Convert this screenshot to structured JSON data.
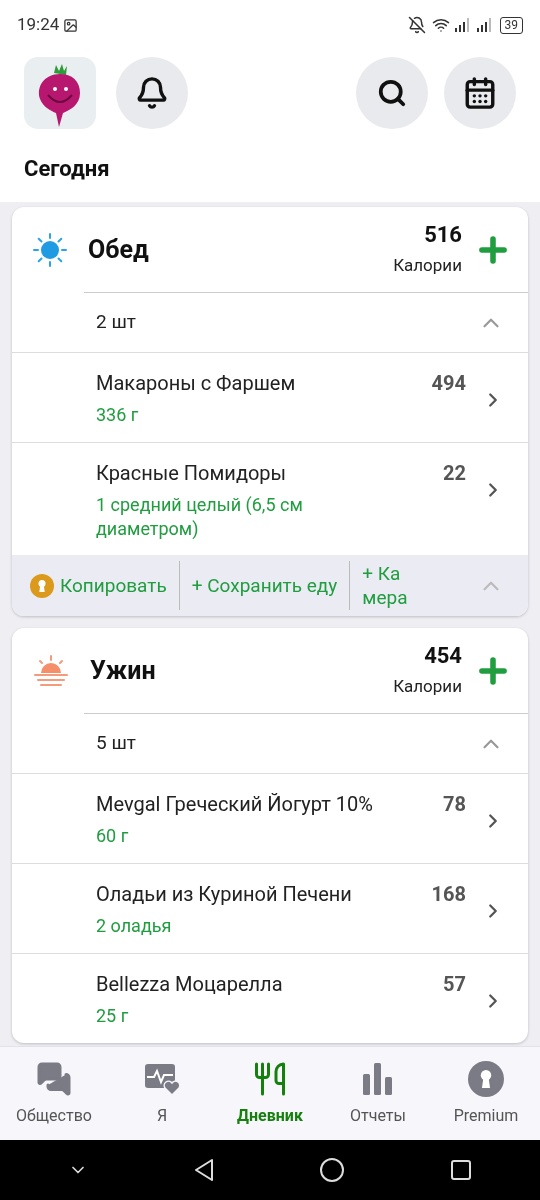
{
  "status_bar": {
    "time": "19:24",
    "battery": "39"
  },
  "title": "Сегодня",
  "meals": [
    {
      "kind": "lunch",
      "name": "Обед",
      "calories": "516",
      "calories_label": "Калории",
      "count": "2 шт",
      "expanded": true,
      "items": [
        {
          "name": "Макароны с Фаршем",
          "calories": "494",
          "amount": "336 г"
        },
        {
          "name": "Красные Помидоры",
          "calories": "22",
          "amount": "1 средний целый (6,5 см диаметром)"
        }
      ],
      "actions": [
        {
          "kind": "copy",
          "label": "Копировать"
        },
        {
          "kind": "save",
          "label": "+ Сохранить еду"
        },
        {
          "kind": "camera",
          "label": "+ Камера"
        }
      ]
    },
    {
      "kind": "dinner",
      "name": "Ужин",
      "calories": "454",
      "calories_label": "Калории",
      "count": "5 шт",
      "expanded": true,
      "items": [
        {
          "name": "Mevgal Греческий Йогурт 10%",
          "calories": "78",
          "amount": "60 г"
        },
        {
          "name": "Оладьи из Куриной Печени",
          "calories": "168",
          "amount": "2 оладья"
        },
        {
          "name": "Bellezza Моцарелла",
          "calories": "57",
          "amount": "25 г"
        }
      ]
    }
  ],
  "bottom_nav": [
    {
      "kind": "community",
      "label": "Общество",
      "selected": false
    },
    {
      "kind": "me",
      "label": "Я",
      "selected": false
    },
    {
      "kind": "diary",
      "label": "Дневник",
      "selected": true
    },
    {
      "kind": "reports",
      "label": "Отчеты",
      "selected": false
    },
    {
      "kind": "premium",
      "label": "Premium",
      "selected": false
    }
  ]
}
